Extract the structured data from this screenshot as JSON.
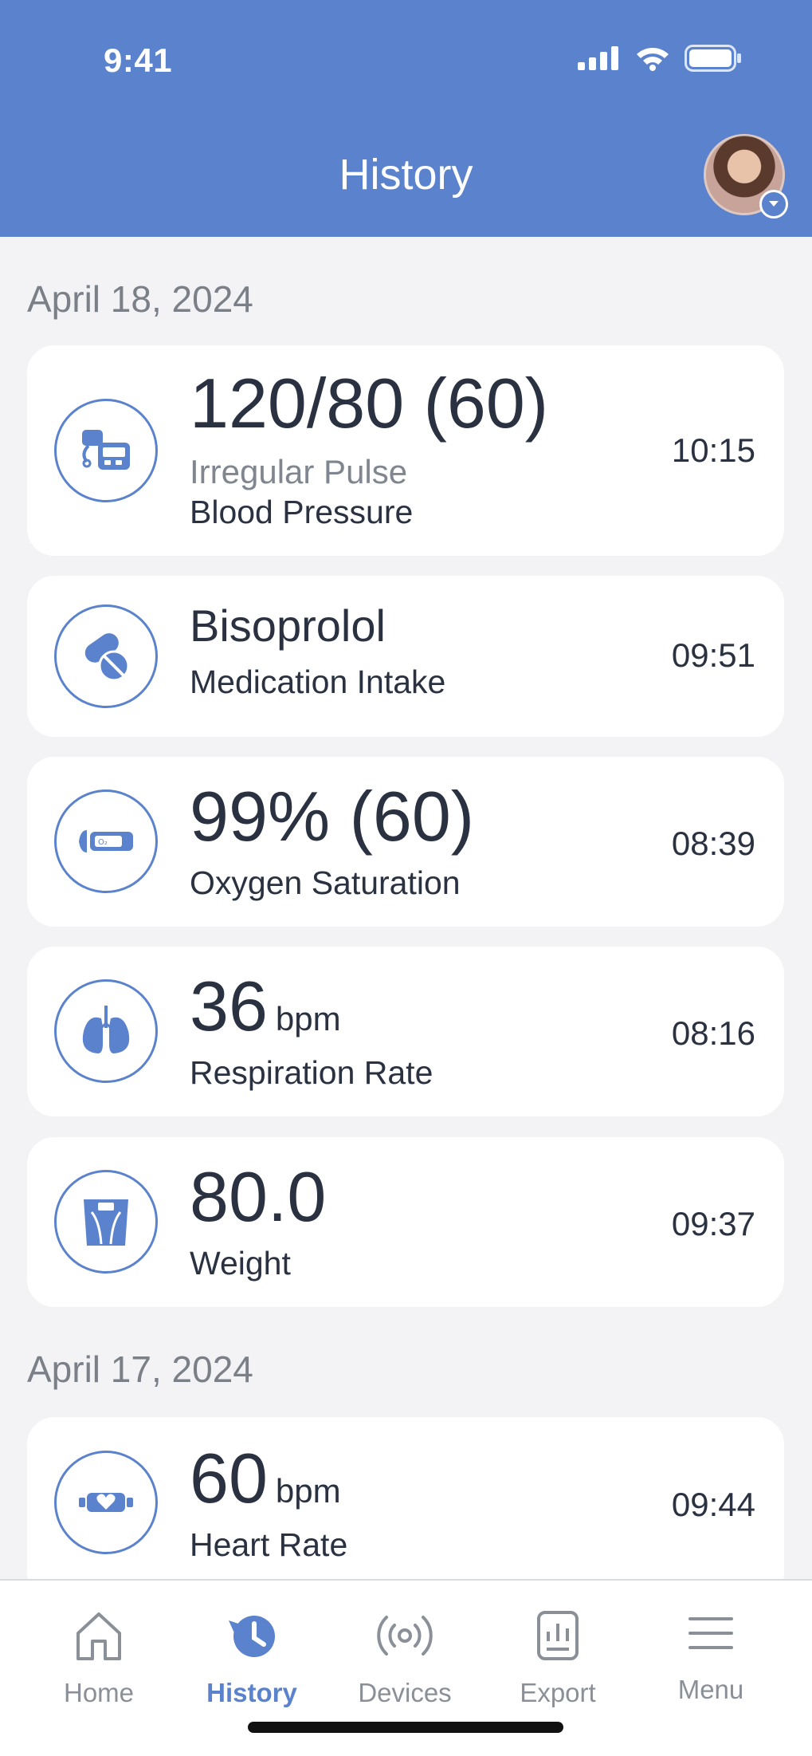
{
  "status_bar": {
    "time": "9:41"
  },
  "header": {
    "title": "History"
  },
  "sections": [
    {
      "date": "April 18, 2024",
      "entries": [
        {
          "icon": "blood-pressure-monitor-icon",
          "value": "120/80 (60)",
          "note": "Irregular Pulse",
          "label": "Blood Pressure",
          "time": "10:15"
        },
        {
          "icon": "pill-icon",
          "value": "Bisoprolol",
          "label": "Medication Intake",
          "time": "09:51"
        },
        {
          "icon": "pulse-oximeter-icon",
          "value": "99% (60)",
          "label": "Oxygen Saturation",
          "time": "08:39"
        },
        {
          "icon": "lungs-icon",
          "value": "36",
          "unit": "bpm",
          "label": "Respiration Rate",
          "time": "08:16"
        },
        {
          "icon": "weight-scale-icon",
          "value": "80.0",
          "label": "Weight",
          "time": "09:37"
        }
      ]
    },
    {
      "date": "April 17, 2024",
      "entries": [
        {
          "icon": "heart-rate-band-icon",
          "value": "60",
          "unit": "bpm",
          "label": "Heart Rate",
          "time": "09:44"
        }
      ]
    }
  ],
  "tabbar": {
    "items": [
      {
        "label": "Home",
        "icon": "home-icon"
      },
      {
        "label": "History",
        "icon": "history-icon",
        "active": true
      },
      {
        "label": "Devices",
        "icon": "devices-icon"
      },
      {
        "label": "Export",
        "icon": "export-icon"
      },
      {
        "label": "Menu",
        "icon": "menu-icon"
      }
    ]
  },
  "colors": {
    "accent": "#5b82cc",
    "background": "#f3f3f5",
    "text": "#2a3140",
    "muted": "#7a7f88"
  }
}
